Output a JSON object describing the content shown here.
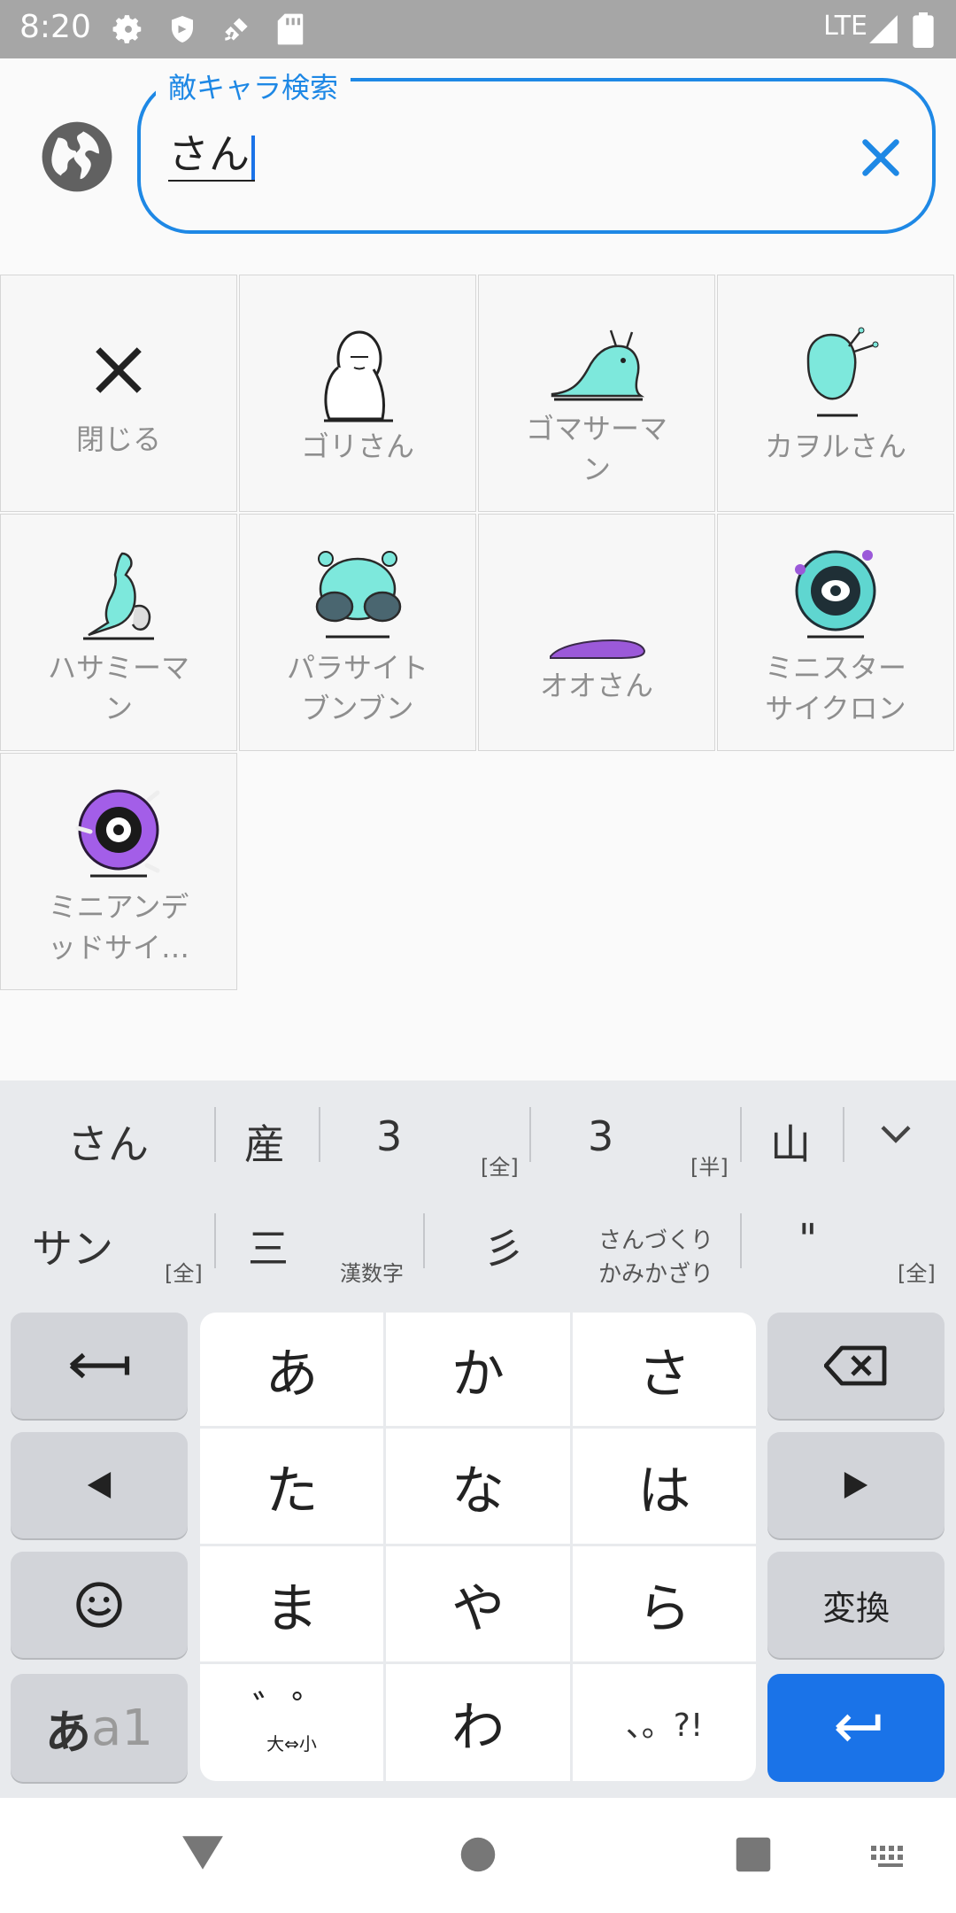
{
  "status_bar": {
    "time": "8:20",
    "network": "LTE",
    "icons": [
      "gear-icon",
      "shield-icon",
      "satellite-icon",
      "sd-card-icon",
      "signal-icon",
      "battery-icon"
    ]
  },
  "search": {
    "label": "敵キャラ検索",
    "value": "さん",
    "accent_color": "#1e88e5"
  },
  "grid": {
    "close_label": "閉じる",
    "items": [
      {
        "name": "ゴリさん"
      },
      {
        "name": "ゴマサーマン"
      },
      {
        "name": "カヲルさん"
      },
      {
        "name": "ハサミーマン"
      },
      {
        "name": "パラサイトブンブン"
      },
      {
        "name": "オオさん"
      },
      {
        "name": "ミニスターサイクロン"
      },
      {
        "name": "ミニアンデッドサイ…"
      }
    ],
    "lines": {
      "goma_1": "ゴマサーマ",
      "goma_2": "ン",
      "hasami_1": "ハサミーマ",
      "hasami_2": "ン",
      "para_1": "パラサイト",
      "para_2": "ブンブン",
      "mini_1": "ミニスター",
      "mini_2": "サイクロン",
      "undead_1": "ミニアンデ",
      "undead_2": "ッドサイ…"
    }
  },
  "keyboard": {
    "candidates_row1": [
      "さん",
      "産",
      "3",
      "3",
      "山"
    ],
    "candidates_row1_tags": [
      "[全]",
      "[半]"
    ],
    "candidates_row2": [
      "サン",
      "三",
      "彡",
      "さんづくり",
      "かみかざり",
      "\""
    ],
    "candidates_row2_tags": [
      "[全]",
      "漢数字",
      "[全]"
    ],
    "keys": [
      "あ",
      "か",
      "さ",
      "た",
      "な",
      "は",
      "ま",
      "や",
      "ら",
      "わ"
    ],
    "dakuten_label": "゛゜",
    "size_toggle": "大⇔小",
    "punct": "、。?!",
    "convert": "変換",
    "mode_label_1": "あ",
    "mode_label_2": "a1",
    "enter_color": "#1a73e8"
  }
}
